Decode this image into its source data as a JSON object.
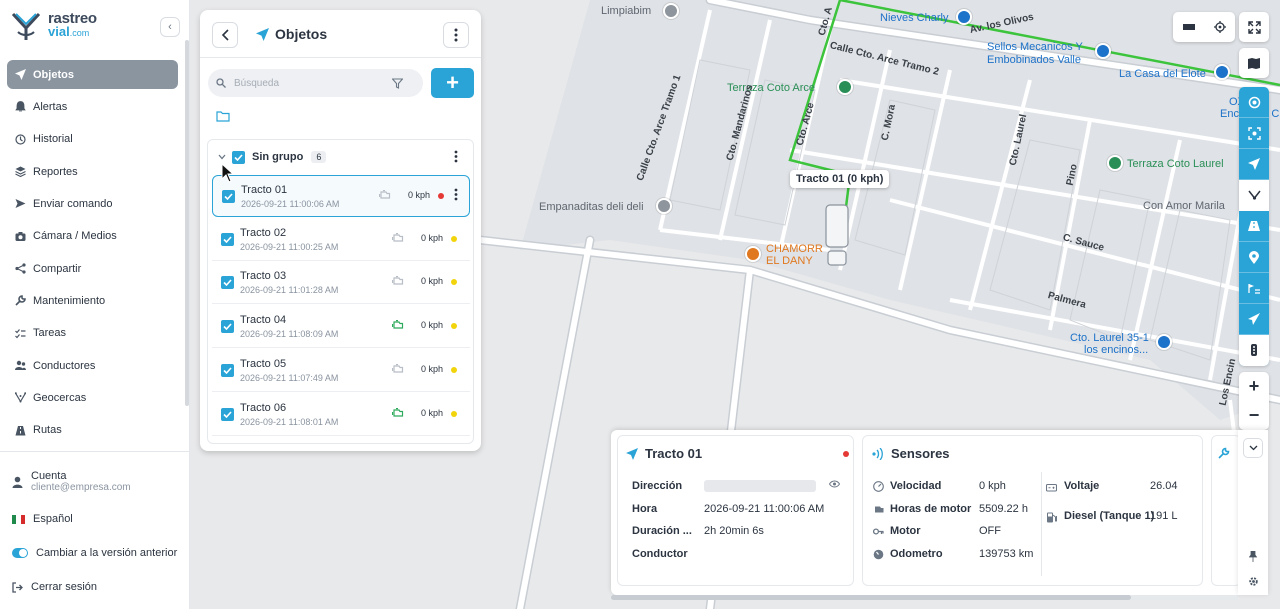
{
  "brand": {
    "line1": "rastreo",
    "line2": "vial",
    "tld": ".com"
  },
  "nav": {
    "items": [
      {
        "label": "Objetos",
        "icon": "navigation-arrow-icon"
      },
      {
        "label": "Alertas",
        "icon": "bell-icon"
      },
      {
        "label": "Historial",
        "icon": "history-icon"
      },
      {
        "label": "Reportes",
        "icon": "layers-icon"
      },
      {
        "label": "Enviar comando",
        "icon": "send-icon"
      },
      {
        "label": "Cámara / Medios",
        "icon": "camera-icon"
      },
      {
        "label": "Compartir",
        "icon": "share-icon"
      },
      {
        "label": "Mantenimiento",
        "icon": "wrench-icon"
      },
      {
        "label": "Tareas",
        "icon": "checklist-icon"
      },
      {
        "label": "Conductores",
        "icon": "users-icon"
      },
      {
        "label": "Geocercas",
        "icon": "geofence-icon"
      },
      {
        "label": "Rutas",
        "icon": "route-icon"
      }
    ]
  },
  "account": {
    "label": "Cuenta",
    "email": "cliente@empresa.com"
  },
  "language": "Español",
  "legacy_toggle": "Cambiar a la versión anterior",
  "logout": "Cerrar sesión",
  "objects_panel": {
    "title": "Objetos",
    "search_placeholder": "Búsqueda",
    "group": {
      "name": "Sin grupo",
      "count": "6"
    },
    "rows": [
      {
        "name": "Tracto 01",
        "datetime": "2026-09-21 11:00:06 AM",
        "speed": "0 kph",
        "status_color": "#e53935",
        "engine_color": "#b8bec6"
      },
      {
        "name": "Tracto 02",
        "datetime": "2026-09-21 11:00:25 AM",
        "speed": "0 kph",
        "status_color": "#f2d40c",
        "engine_color": "#b8bec6"
      },
      {
        "name": "Tracto 03",
        "datetime": "2026-09-21 11:01:28 AM",
        "speed": "0 kph",
        "status_color": "#f2d40c",
        "engine_color": "#b8bec6"
      },
      {
        "name": "Tracto 04",
        "datetime": "2026-09-21 11:08:09 AM",
        "speed": "0 kph",
        "status_color": "#f2d40c",
        "engine_color": "#2eaa5c"
      },
      {
        "name": "Tracto 05",
        "datetime": "2026-09-21 11:07:49 AM",
        "speed": "0 kph",
        "status_color": "#f2d40c",
        "engine_color": "#b8bec6"
      },
      {
        "name": "Tracto 06",
        "datetime": "2026-09-21 11:08:01 AM",
        "speed": "0 kph",
        "status_color": "#f2d40c",
        "engine_color": "#2eaa5c"
      }
    ]
  },
  "map": {
    "pois": [
      {
        "text": "Limpiabim",
        "style": "grey"
      },
      {
        "text": "Nieves Charly",
        "style": "blue"
      },
      {
        "text": "Sellos Mecanicos Y",
        "style": "blue"
      },
      {
        "text": "Embobinados Valle",
        "style": "blue"
      },
      {
        "text": "La Casa del Elote",
        "style": "blue"
      },
      {
        "text": "OXXO",
        "style": "blue"
      },
      {
        "text": "Encinos II C",
        "style": "blue"
      },
      {
        "text": "Terraza Coto Arce",
        "style": "green"
      },
      {
        "text": "Terraza Coto Laurel",
        "style": "green"
      },
      {
        "text": "Con Amor Marila",
        "style": "grey"
      },
      {
        "text": "Empanaditas deli deli",
        "style": "grey"
      },
      {
        "text": "CHAMORR",
        "style": "orange"
      },
      {
        "text": "EL DANY",
        "style": "orange"
      },
      {
        "text": "Cto. Laurel 35-1",
        "style": "blue"
      },
      {
        "text": "los encinos...",
        "style": "blue"
      }
    ],
    "streets": [
      "Av. los Olivos",
      "Calle Cto. Arce Tramo 2",
      "Calle Cto. Arce Tramo 1",
      "Cto. Mandarinos",
      "Cto. Arce",
      "C. Mora",
      "Cto. Laurel",
      "Pino",
      "C. Sauce",
      "Palmera",
      "Los Encin",
      "Cto. A"
    ],
    "vehicle_label": "Tracto 01 (0 kph)"
  },
  "info_panel": {
    "object": {
      "title": "Tracto 01",
      "status_color": "#e53935",
      "fields": [
        {
          "label": "Dirección",
          "value": ""
        },
        {
          "label": "Hora",
          "value": "2026-09-21 11:00:06 AM"
        },
        {
          "label": "Duración ...",
          "value": "2h 20min 6s"
        },
        {
          "label": "Conductor",
          "value": ""
        }
      ]
    },
    "sensors": {
      "title": "Sensores",
      "left": [
        {
          "label": "Velocidad",
          "value": "0 kph",
          "icon": "speedometer-icon"
        },
        {
          "label": "Horas de motor",
          "value": "5509.22 h",
          "icon": "engine-icon"
        },
        {
          "label": "Motor",
          "value": "OFF",
          "icon": "key-icon"
        },
        {
          "label": "Odometro",
          "value": "139753 km",
          "icon": "odometer-icon"
        }
      ],
      "right": [
        {
          "label": "Voltaje",
          "value": "26.04",
          "icon": "battery-icon"
        },
        {
          "label": "Diesel (Tanque 1)",
          "value": "191 L",
          "icon": "fuel-icon"
        }
      ]
    }
  },
  "colors": {
    "accent": "#2aa3d6",
    "route": "#3cc43c",
    "active_nav": "#8a95a0"
  }
}
